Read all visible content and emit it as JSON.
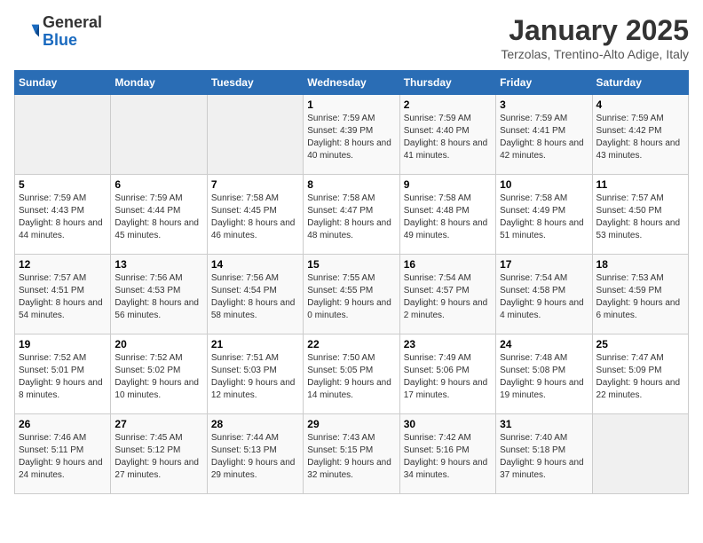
{
  "logo": {
    "general": "General",
    "blue": "Blue"
  },
  "title": "January 2025",
  "subtitle": "Terzolas, Trentino-Alto Adige, Italy",
  "days_of_week": [
    "Sunday",
    "Monday",
    "Tuesday",
    "Wednesday",
    "Thursday",
    "Friday",
    "Saturday"
  ],
  "weeks": [
    [
      {
        "day": "",
        "info": ""
      },
      {
        "day": "",
        "info": ""
      },
      {
        "day": "",
        "info": ""
      },
      {
        "day": "1",
        "info": "Sunrise: 7:59 AM\nSunset: 4:39 PM\nDaylight: 8 hours and 40 minutes."
      },
      {
        "day": "2",
        "info": "Sunrise: 7:59 AM\nSunset: 4:40 PM\nDaylight: 8 hours and 41 minutes."
      },
      {
        "day": "3",
        "info": "Sunrise: 7:59 AM\nSunset: 4:41 PM\nDaylight: 8 hours and 42 minutes."
      },
      {
        "day": "4",
        "info": "Sunrise: 7:59 AM\nSunset: 4:42 PM\nDaylight: 8 hours and 43 minutes."
      }
    ],
    [
      {
        "day": "5",
        "info": "Sunrise: 7:59 AM\nSunset: 4:43 PM\nDaylight: 8 hours and 44 minutes."
      },
      {
        "day": "6",
        "info": "Sunrise: 7:59 AM\nSunset: 4:44 PM\nDaylight: 8 hours and 45 minutes."
      },
      {
        "day": "7",
        "info": "Sunrise: 7:58 AM\nSunset: 4:45 PM\nDaylight: 8 hours and 46 minutes."
      },
      {
        "day": "8",
        "info": "Sunrise: 7:58 AM\nSunset: 4:47 PM\nDaylight: 8 hours and 48 minutes."
      },
      {
        "day": "9",
        "info": "Sunrise: 7:58 AM\nSunset: 4:48 PM\nDaylight: 8 hours and 49 minutes."
      },
      {
        "day": "10",
        "info": "Sunrise: 7:58 AM\nSunset: 4:49 PM\nDaylight: 8 hours and 51 minutes."
      },
      {
        "day": "11",
        "info": "Sunrise: 7:57 AM\nSunset: 4:50 PM\nDaylight: 8 hours and 53 minutes."
      }
    ],
    [
      {
        "day": "12",
        "info": "Sunrise: 7:57 AM\nSunset: 4:51 PM\nDaylight: 8 hours and 54 minutes."
      },
      {
        "day": "13",
        "info": "Sunrise: 7:56 AM\nSunset: 4:53 PM\nDaylight: 8 hours and 56 minutes."
      },
      {
        "day": "14",
        "info": "Sunrise: 7:56 AM\nSunset: 4:54 PM\nDaylight: 8 hours and 58 minutes."
      },
      {
        "day": "15",
        "info": "Sunrise: 7:55 AM\nSunset: 4:55 PM\nDaylight: 9 hours and 0 minutes."
      },
      {
        "day": "16",
        "info": "Sunrise: 7:54 AM\nSunset: 4:57 PM\nDaylight: 9 hours and 2 minutes."
      },
      {
        "day": "17",
        "info": "Sunrise: 7:54 AM\nSunset: 4:58 PM\nDaylight: 9 hours and 4 minutes."
      },
      {
        "day": "18",
        "info": "Sunrise: 7:53 AM\nSunset: 4:59 PM\nDaylight: 9 hours and 6 minutes."
      }
    ],
    [
      {
        "day": "19",
        "info": "Sunrise: 7:52 AM\nSunset: 5:01 PM\nDaylight: 9 hours and 8 minutes."
      },
      {
        "day": "20",
        "info": "Sunrise: 7:52 AM\nSunset: 5:02 PM\nDaylight: 9 hours and 10 minutes."
      },
      {
        "day": "21",
        "info": "Sunrise: 7:51 AM\nSunset: 5:03 PM\nDaylight: 9 hours and 12 minutes."
      },
      {
        "day": "22",
        "info": "Sunrise: 7:50 AM\nSunset: 5:05 PM\nDaylight: 9 hours and 14 minutes."
      },
      {
        "day": "23",
        "info": "Sunrise: 7:49 AM\nSunset: 5:06 PM\nDaylight: 9 hours and 17 minutes."
      },
      {
        "day": "24",
        "info": "Sunrise: 7:48 AM\nSunset: 5:08 PM\nDaylight: 9 hours and 19 minutes."
      },
      {
        "day": "25",
        "info": "Sunrise: 7:47 AM\nSunset: 5:09 PM\nDaylight: 9 hours and 22 minutes."
      }
    ],
    [
      {
        "day": "26",
        "info": "Sunrise: 7:46 AM\nSunset: 5:11 PM\nDaylight: 9 hours and 24 minutes."
      },
      {
        "day": "27",
        "info": "Sunrise: 7:45 AM\nSunset: 5:12 PM\nDaylight: 9 hours and 27 minutes."
      },
      {
        "day": "28",
        "info": "Sunrise: 7:44 AM\nSunset: 5:13 PM\nDaylight: 9 hours and 29 minutes."
      },
      {
        "day": "29",
        "info": "Sunrise: 7:43 AM\nSunset: 5:15 PM\nDaylight: 9 hours and 32 minutes."
      },
      {
        "day": "30",
        "info": "Sunrise: 7:42 AM\nSunset: 5:16 PM\nDaylight: 9 hours and 34 minutes."
      },
      {
        "day": "31",
        "info": "Sunrise: 7:40 AM\nSunset: 5:18 PM\nDaylight: 9 hours and 37 minutes."
      },
      {
        "day": "",
        "info": ""
      }
    ]
  ]
}
